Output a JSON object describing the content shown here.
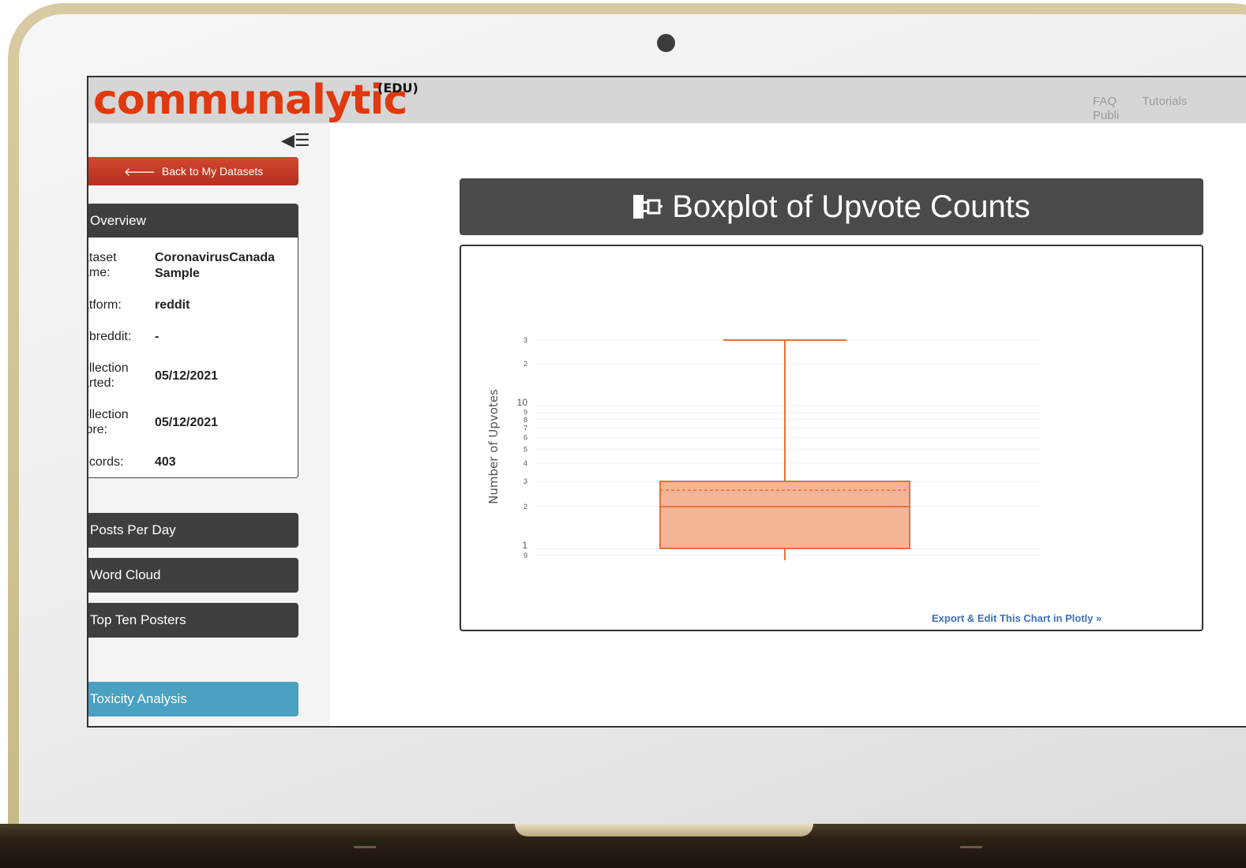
{
  "app": {
    "logo": "communalytic",
    "edition": "(EDU)"
  },
  "topnav": [
    "FAQ",
    "Tutorials",
    "Publi"
  ],
  "sidebar": {
    "back_label": "Back to My Datasets",
    "overview": {
      "title": "Overview",
      "rows": [
        {
          "key": "ataset\name:",
          "value": "CoronavirusCanada Sample"
        },
        {
          "key": "atform:",
          "value": "reddit"
        },
        {
          "key": "ubreddit:",
          "value": "-"
        },
        {
          "key": "ollection\narted:",
          "value": "05/12/2021"
        },
        {
          "key": "ollection\nfore:",
          "value": "05/12/2021"
        },
        {
          "key": "ecords:",
          "value": "403"
        }
      ]
    },
    "nav": [
      "Posts Per Day",
      "Word Cloud",
      "Top Ten Posters"
    ],
    "toxicity_label": "Toxicity Analysis"
  },
  "main": {
    "chart_title": "Boxplot of Upvote Counts",
    "export_label": "Export & Edit This Chart in Plotly »"
  },
  "colors": {
    "accent": "#e0380f",
    "box_fill": "#f4b597",
    "box_line": "#e8703a",
    "toxicity": "#4aa1c2"
  },
  "chart_data": {
    "type": "box",
    "title": "Boxplot of Upvote Counts",
    "ylabel": "Number of Upvotes",
    "yscale": "log",
    "ytick_labels": [
      "9",
      "1",
      "2",
      "3",
      "4",
      "5",
      "6",
      "7",
      "8",
      "9",
      "10",
      "2",
      "3"
    ],
    "box": {
      "whisker_low": 0.9,
      "q1": 1,
      "median": 2,
      "mean": 2.6,
      "q3": 3,
      "whisker_high": 300
    }
  }
}
